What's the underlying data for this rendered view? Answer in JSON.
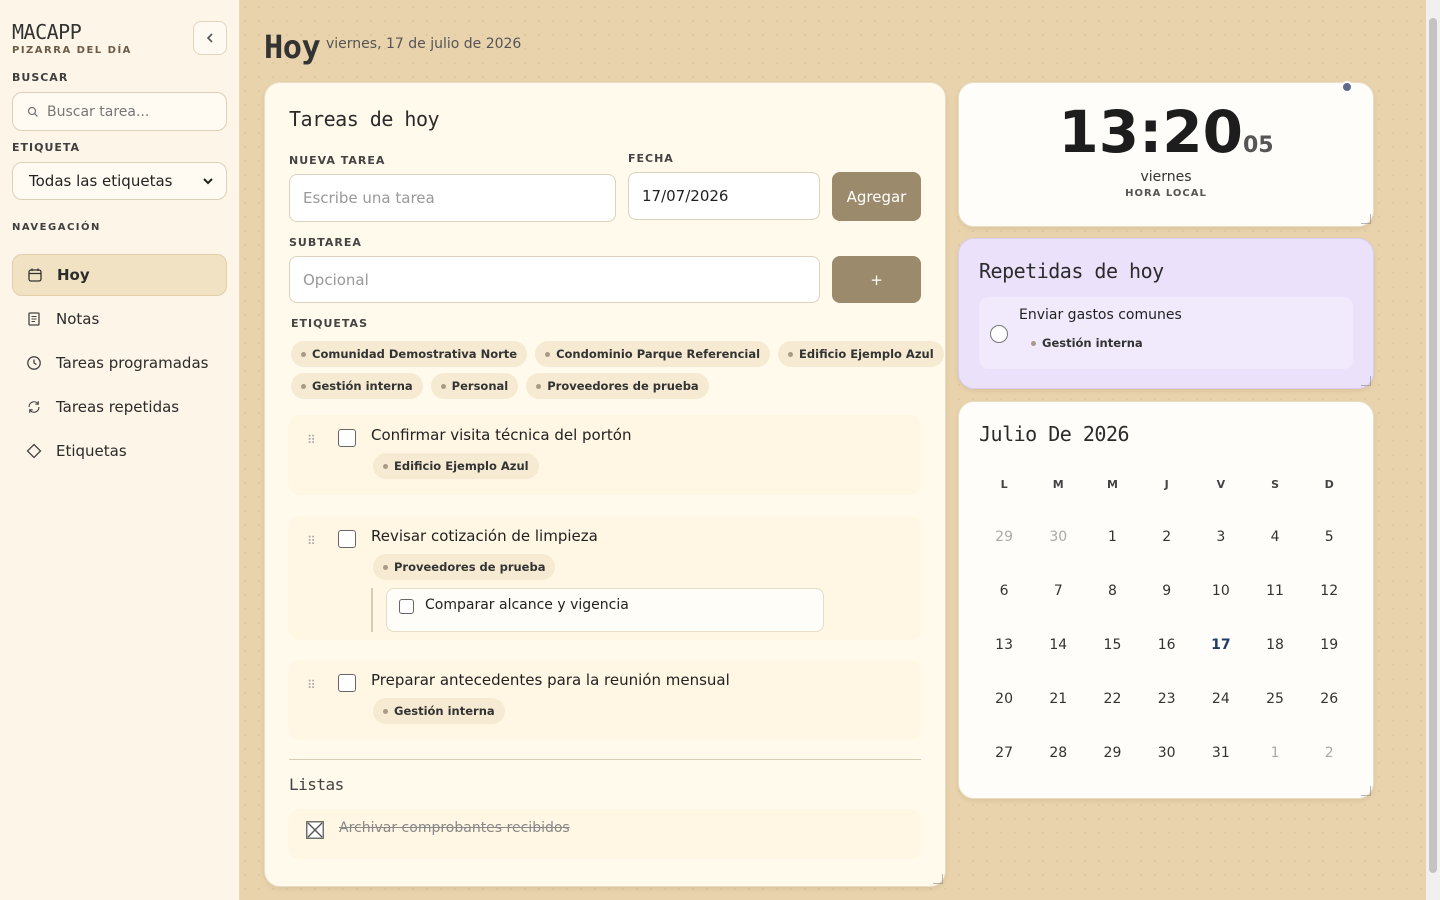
{
  "brand": {
    "title": "MACAPP",
    "subtitle": "PIZARRA DEL DÍA"
  },
  "sidebar": {
    "search_label": "BUSCAR",
    "search_placeholder": "Buscar tarea...",
    "tag_label": "ETIQUETA",
    "tag_selected": "Todas las etiquetas",
    "nav_label": "NAVEGACIÓN",
    "items": [
      {
        "label": "Hoy",
        "icon": "calendar-icon",
        "active": true
      },
      {
        "label": "Notas",
        "icon": "note-icon"
      },
      {
        "label": "Tareas programadas",
        "icon": "clock-icon"
      },
      {
        "label": "Tareas repetidas",
        "icon": "repeat-icon"
      },
      {
        "label": "Etiquetas",
        "icon": "tag-icon"
      }
    ]
  },
  "header": {
    "title": "Hoy",
    "date": "viernes, 17 de julio de 2026"
  },
  "main": {
    "title": "Tareas de hoy",
    "new_task_label": "NUEVA TAREA",
    "new_task_placeholder": "Escribe una tarea",
    "date_label": "FECHA",
    "date_value": "17/07/2026",
    "add_button": "Agregar",
    "subtask_label": "SUBTAREA",
    "subtask_placeholder": "Opcional",
    "subtask_button": "+",
    "tags_label": "ETIQUETAS",
    "tags": [
      "Comunidad Demostrativa Norte",
      "Condominio Parque Referencial",
      "Edificio Ejemplo Azul",
      "Gestión interna",
      "Personal",
      "Proveedores de prueba"
    ],
    "tasks": [
      {
        "text": "Confirmar visita técnica del portón",
        "tag": "Edificio Ejemplo Azul"
      },
      {
        "text": "Revisar cotización de limpieza",
        "tag": "Proveedores de prueba",
        "subtask": "Comparar alcance y vigencia"
      },
      {
        "text": "Preparar antecedentes para la reunión mensual",
        "tag": "Gestión interna"
      }
    ],
    "lists_title": "Listas",
    "list_items": [
      {
        "text": "Archivar comprobantes recibidos",
        "done": true
      }
    ]
  },
  "clock": {
    "hm": "13:20",
    "seconds": "05",
    "day": "viernes",
    "zone": "HORA LOCAL"
  },
  "repeated": {
    "title": "Repetidas de hoy",
    "items": [
      {
        "text": "Enviar gastos comunes",
        "tag": "Gestión interna"
      }
    ]
  },
  "calendar": {
    "title": "Julio De 2026",
    "weekdays": [
      "L",
      "M",
      "M",
      "J",
      "V",
      "S",
      "D"
    ],
    "weeks": [
      [
        "29",
        "30",
        "1",
        "2",
        "3",
        "4",
        "5"
      ],
      [
        "6",
        "7",
        "8",
        "9",
        "10",
        "11",
        "12"
      ],
      [
        "13",
        "14",
        "15",
        "16",
        "17",
        "18",
        "19"
      ],
      [
        "20",
        "21",
        "22",
        "23",
        "24",
        "25",
        "26"
      ],
      [
        "27",
        "28",
        "29",
        "30",
        "31",
        "1",
        "2"
      ]
    ],
    "today": "17"
  },
  "colors": {
    "accent_brown": "#9b8a6b",
    "repeat_bg": "#ebe1fa",
    "today_bg": "#e2eefb"
  }
}
